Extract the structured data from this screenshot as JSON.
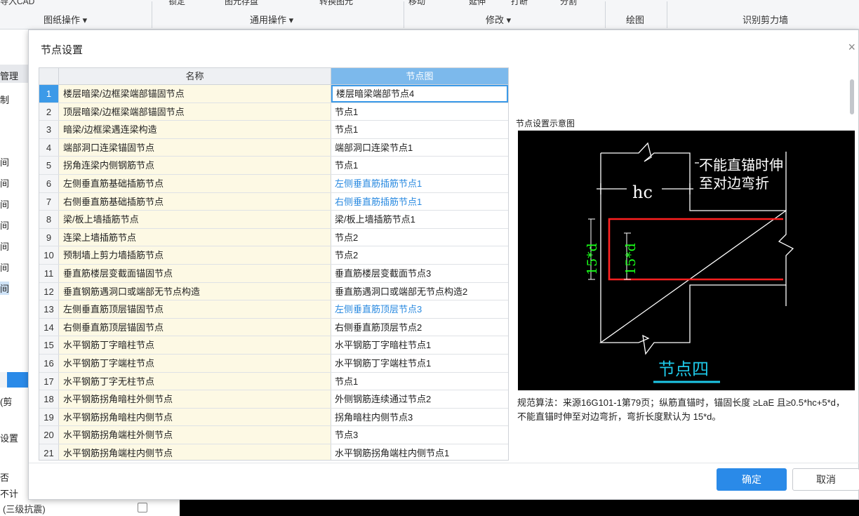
{
  "ribbon": {
    "cut_items": [
      "导入CAD",
      "锁定",
      "图元存盘",
      "转换图元",
      "移动",
      "延伸",
      "打断",
      "分割"
    ],
    "groups": [
      "图纸操作 ▾",
      "通用操作 ▾",
      "修改 ▾",
      "绘图",
      "识别剪力墙"
    ]
  },
  "left_panel": {
    "items": [
      "管理",
      "制",
      "间",
      "间",
      "间",
      "间",
      "间",
      "间",
      "间",
      "(剪",
      "设置",
      "否",
      "不计",
      "(三级抗震)"
    ]
  },
  "dialog": {
    "title": "节点设置",
    "close": "×",
    "columns": {
      "name": "名称",
      "node": "节点图"
    },
    "rows": [
      {
        "idx": "1",
        "name": "楼层暗梁/边框梁端部锚固节点",
        "node": "楼层暗梁端部节点4",
        "selected": true,
        "blue": false
      },
      {
        "idx": "2",
        "name": "顶层暗梁/边框梁端部锚固节点",
        "node": "节点1",
        "blue": false
      },
      {
        "idx": "3",
        "name": "暗梁/边框梁遇连梁构造",
        "node": "节点1",
        "blue": false
      },
      {
        "idx": "4",
        "name": "端部洞口连梁锚固节点",
        "node": "端部洞口连梁节点1",
        "blue": false
      },
      {
        "idx": "5",
        "name": "拐角连梁内侧钢筋节点",
        "node": "节点1",
        "blue": false
      },
      {
        "idx": "6",
        "name": "左侧垂直筋基础插筋节点",
        "node": "左侧垂直筋插筋节点1",
        "blue": true
      },
      {
        "idx": "7",
        "name": "右侧垂直筋基础插筋节点",
        "node": "右侧垂直筋插筋节点1",
        "blue": true
      },
      {
        "idx": "8",
        "name": "梁/板上墙插筋节点",
        "node": "梁/板上墙插筋节点1",
        "blue": false
      },
      {
        "idx": "9",
        "name": "连梁上墙插筋节点",
        "node": "节点2",
        "blue": false
      },
      {
        "idx": "10",
        "name": "预制墙上剪力墙插筋节点",
        "node": "节点2",
        "blue": false
      },
      {
        "idx": "11",
        "name": "垂直筋楼层变截面锚固节点",
        "node": "垂直筋楼层变截面节点3",
        "blue": false
      },
      {
        "idx": "12",
        "name": "垂直钢筋遇洞口或端部无节点构造",
        "node": "垂直筋遇洞口或端部无节点构造2",
        "blue": false
      },
      {
        "idx": "13",
        "name": "左侧垂直筋顶层锚固节点",
        "node": "左侧垂直筋顶层节点3",
        "blue": true
      },
      {
        "idx": "14",
        "name": "右侧垂直筋顶层锚固节点",
        "node": "右侧垂直筋顶层节点2",
        "blue": false
      },
      {
        "idx": "15",
        "name": "水平钢筋丁字暗柱节点",
        "node": "水平钢筋丁字暗柱节点1",
        "blue": false
      },
      {
        "idx": "16",
        "name": "水平钢筋丁字端柱节点",
        "node": "水平钢筋丁字端柱节点1",
        "blue": false
      },
      {
        "idx": "17",
        "name": "水平钢筋丁字无柱节点",
        "node": "节点1",
        "blue": false
      },
      {
        "idx": "18",
        "name": "水平钢筋拐角暗柱外侧节点",
        "node": "外侧钢筋连续通过节点2",
        "blue": false
      },
      {
        "idx": "19",
        "name": "水平钢筋拐角暗柱内侧节点",
        "node": "拐角暗柱内侧节点3",
        "blue": false
      },
      {
        "idx": "20",
        "name": "水平钢筋拐角端柱外侧节点",
        "node": "节点3",
        "blue": false
      },
      {
        "idx": "21",
        "name": "水平钢筋拐角端柱内侧节点",
        "node": "水平钢筋拐角端柱内侧节点1",
        "blue": false
      }
    ],
    "preview": {
      "title": "节点设置示意图",
      "note_line1": "不能直锚时伸",
      "note_line2": "至对边弯折",
      "hc": "hc",
      "dim_outer": "15*d",
      "dim_inner": "15*d",
      "caption": "节点四",
      "rule": "规范算法：来源16G101-1第79页；纵筋直锚时，锚固长度 ≥LaE 且≥0.5*hc+5*d，不能直锚时伸至对边弯折，弯折长度默认为 15*d。"
    },
    "buttons": {
      "ok": "确定",
      "cancel": "取消"
    }
  }
}
